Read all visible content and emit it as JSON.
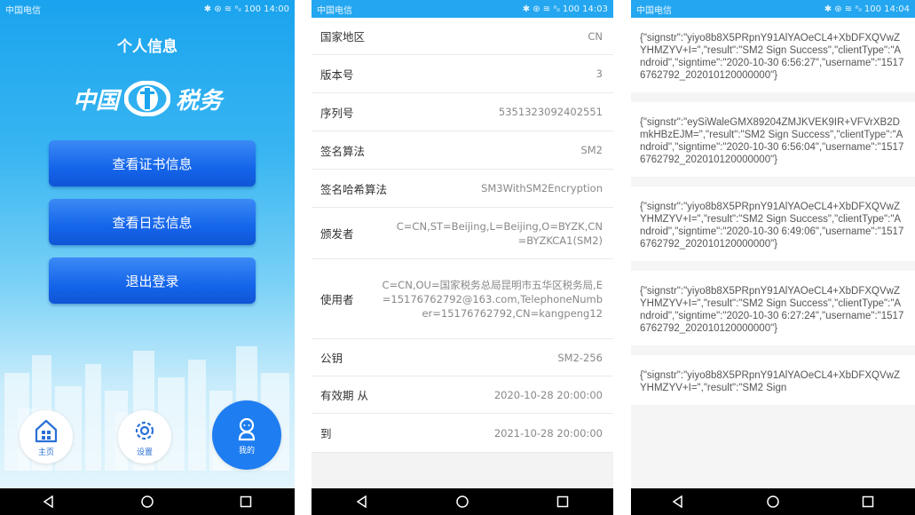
{
  "status": {
    "carrier": "中国电信",
    "s1_right": "✱ ⊛ ≋ ᵃᵢₗ 100 14:00",
    "s2_right": "✱ ⊛ ≋ ᵃᵢₗ 100 14:03",
    "s3_right": "✱ ⊛ ≋ ᵃᵢₗ 100 14:04"
  },
  "home": {
    "title": "个人信息",
    "logo_left": "中国",
    "logo_right": "税务",
    "buttons": [
      "查看证书信息",
      "查看日志信息",
      "退出登录"
    ],
    "tabs": [
      {
        "label": "主页",
        "icon": "home-icon"
      },
      {
        "label": "设置",
        "icon": "gear-icon"
      },
      {
        "label": "我的",
        "icon": "user-icon"
      }
    ]
  },
  "cert": {
    "rows": [
      {
        "key": "国家地区",
        "value": "CN"
      },
      {
        "key": "版本号",
        "value": "3"
      },
      {
        "key": "序列号",
        "value": "5351323092402551"
      },
      {
        "key": "签名算法",
        "value": "SM2"
      },
      {
        "key": "签名哈希算法",
        "value": "SM3WithSM2Encryption"
      },
      {
        "key": "颁发者",
        "value": "C=CN,ST=Beijing,L=Beijing,O=BYZK,CN=BYZKCA1(SM2)"
      },
      {
        "key": "使用者",
        "value": "C=CN,OU=国家税务总局昆明市五华区税务局,E=15176762792@163.com,TelephoneNumber=15176762792,CN=kangpeng12"
      },
      {
        "key": "公钥",
        "value": "SM2-256"
      },
      {
        "key": "有效期 从",
        "value": "2020-10-28 20:00:00"
      },
      {
        "key": "到",
        "value": "2021-10-28 20:00:00"
      }
    ]
  },
  "logs": {
    "items": [
      "{\"signstr\":\"yiyo8b8X5PRpnY91AlYAOeCL4+XbDFXQVwZYHMZYV+I=\",\"result\":\"SM2 Sign Success\",\"clientType\":\"Android\",\"signtime\":\"2020-10-30 6:56:27\",\"username\":\"15176762792_202010120000000\"}",
      "{\"signstr\":\"eySiWaleGMX89204ZMJKVEK9IR+VFVrXB2DmkHBzEJM=\",\"result\":\"SM2 Sign Success\",\"clientType\":\"Android\",\"signtime\":\"2020-10-30 6:56:04\",\"username\":\"15176762792_202010120000000\"}",
      "{\"signstr\":\"yiyo8b8X5PRpnY91AlYAOeCL4+XbDFXQVwZYHMZYV+I=\",\"result\":\"SM2 Sign Success\",\"clientType\":\"Android\",\"signtime\":\"2020-10-30 6:49:06\",\"username\":\"15176762792_202010120000000\"}",
      "{\"signstr\":\"yiyo8b8X5PRpnY91AlYAOeCL4+XbDFXQVwZYHMZYV+I=\",\"result\":\"SM2 Sign Success\",\"clientType\":\"Android\",\"signtime\":\"2020-10-30 6:27:24\",\"username\":\"15176762792_202010120000000\"}",
      "{\"signstr\":\"yiyo8b8X5PRpnY91AlYAOeCL4+XbDFXQVwZYHMZYV+I=\",\"result\":\"SM2 Sign"
    ]
  },
  "colors": {
    "primary_button": "#1565ea",
    "status_bar": "#24a7f0",
    "active_tab": "#1e7df0"
  }
}
